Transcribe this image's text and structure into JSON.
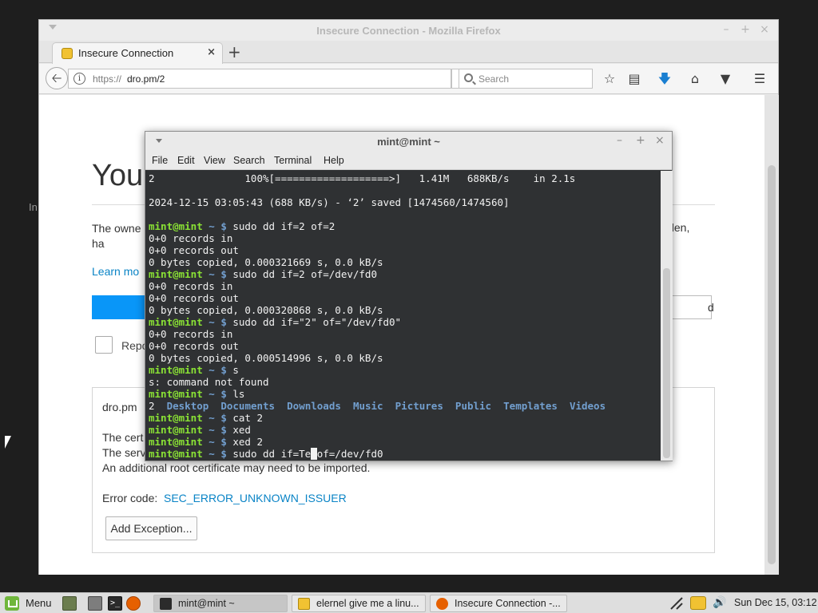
{
  "desktop": {
    "ghost_text": "In"
  },
  "firefox": {
    "window_title": "Insecure Connection - Mozilla Firefox",
    "tab": {
      "label": "Insecure Connection",
      "close": "×"
    },
    "new_tab": "+",
    "url": {
      "scheme": "https://",
      "host": "dro.pm/2"
    },
    "search_placeholder": "Search",
    "page": {
      "title": "You",
      "text_left": "The owne Firefox ha",
      "text_right": "blen,",
      "learn_more": "Learn mo",
      "advanced_button": "d",
      "report_label": "Repo",
      "advanced_panel": {
        "host": "dro.pm",
        "line1": "The cert",
        "line2": "The serv",
        "line3": "An additional root certificate may need to be imported.",
        "error_code_label": "Error code:",
        "error_code": "SEC_ERROR_UNKNOWN_ISSUER",
        "add_exception": "Add Exception..."
      }
    }
  },
  "terminal": {
    "title": "mint@mint ~",
    "menu": [
      "File",
      "Edit",
      "View",
      "Search",
      "Terminal",
      "Help"
    ],
    "prompt_user": "mint@mint",
    "prompt_path": "~",
    "prompt_sym": "$",
    "lines": [
      {
        "type": "out",
        "text": "2               100%[===================>]   1.41M   688KB/s    in 2.1s"
      },
      {
        "type": "out",
        "text": ""
      },
      {
        "type": "out",
        "text": "2024-12-15 03:05:43 (688 KB/s) - ‘2’ saved [1474560/1474560]"
      },
      {
        "type": "out",
        "text": ""
      },
      {
        "type": "cmd",
        "text": "sudo dd if=2 of=2"
      },
      {
        "type": "out",
        "text": "0+0 records in"
      },
      {
        "type": "out",
        "text": "0+0 records out"
      },
      {
        "type": "out",
        "text": "0 bytes copied, 0.000321669 s, 0.0 kB/s"
      },
      {
        "type": "cmd",
        "text": "sudo dd if=2 of=/dev/fd0"
      },
      {
        "type": "out",
        "text": "0+0 records in"
      },
      {
        "type": "out",
        "text": "0+0 records out"
      },
      {
        "type": "out",
        "text": "0 bytes copied, 0.000320868 s, 0.0 kB/s"
      },
      {
        "type": "cmd",
        "text": "sudo dd if=\"2\" of=\"/dev/fd0\""
      },
      {
        "type": "out",
        "text": "0+0 records in"
      },
      {
        "type": "out",
        "text": "0+0 records out"
      },
      {
        "type": "out",
        "text": "0 bytes copied, 0.000514996 s, 0.0 kB/s"
      },
      {
        "type": "cmd",
        "text": "s"
      },
      {
        "type": "out",
        "text": "s: command not found"
      },
      {
        "type": "cmd",
        "text": "ls"
      },
      {
        "type": "ls",
        "items": [
          "2",
          "Desktop",
          "Documents",
          "Downloads",
          "Music",
          "Pictures",
          "Public",
          "Templates",
          "Videos"
        ]
      },
      {
        "type": "cmd",
        "text": "cat 2"
      },
      {
        "type": "cmd",
        "text": "xed"
      },
      {
        "type": "cmd",
        "text": "xed 2"
      },
      {
        "type": "cmd",
        "text": "sudo dd if=Te",
        "cursor": " ",
        "after": "of=/dev/fd0"
      }
    ]
  },
  "taskbar": {
    "menu_label": "Menu",
    "tasks": [
      {
        "label": "mint@mint ~",
        "icon": "terminal-icon"
      },
      {
        "label": "elernel give me a linu...",
        "icon": "text-editor-icon"
      },
      {
        "label": "Insecure Connection -...",
        "icon": "firefox-icon"
      }
    ],
    "clock": "Sun Dec 15, 03:12"
  }
}
